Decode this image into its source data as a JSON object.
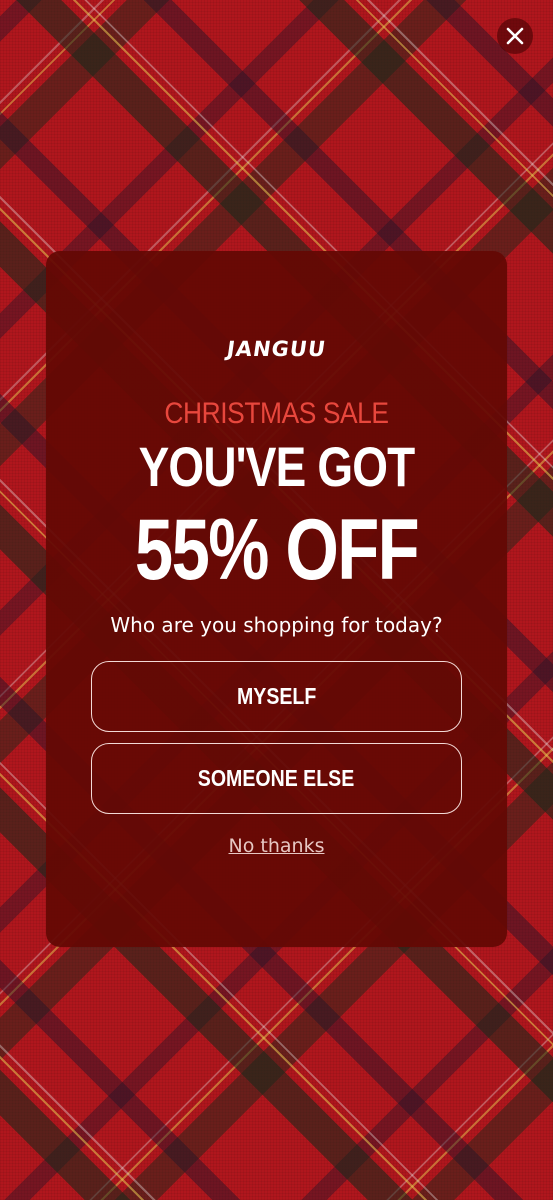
{
  "popup": {
    "logo_text": "JANGUU",
    "eyebrow": "CHRISTMAS SALE",
    "headline": "YOU'VE GOT",
    "discount": "55% OFF",
    "question": "Who are you shopping for today?",
    "options": [
      {
        "label": "MYSELF"
      },
      {
        "label": "SOMEONE ELSE"
      }
    ],
    "dismiss_label": "No thanks"
  },
  "colors": {
    "modal_background": "#640804",
    "eyebrow": "#e8473d",
    "text": "#ffffff",
    "background_plaid": "#b0161d"
  },
  "icons": {
    "close": "close-icon"
  }
}
